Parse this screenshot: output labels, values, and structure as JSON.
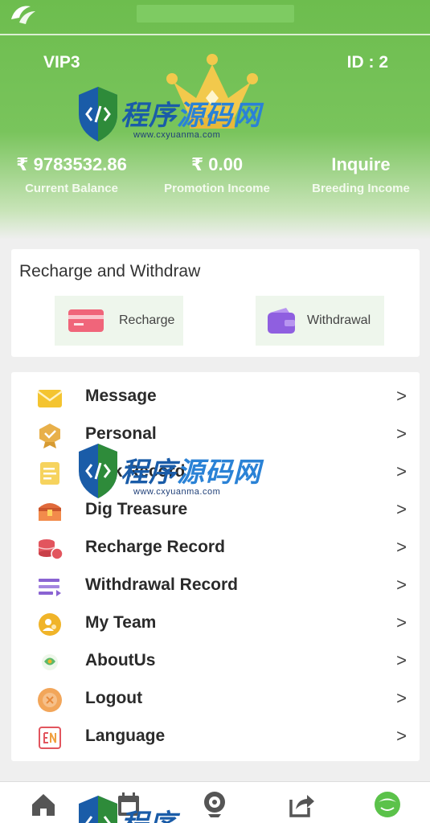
{
  "header": {
    "vip_level": "VIP3",
    "user_id": "ID : 2",
    "stats": [
      {
        "value": "₹ 9783532.86",
        "label": "Current Balance"
      },
      {
        "value": "₹ 0.00",
        "label": "Promotion Income"
      },
      {
        "value": "Inquire",
        "label": "Breeding Income"
      }
    ]
  },
  "recharge_withdraw": {
    "title": "Recharge and Withdraw",
    "recharge_label": "Recharge",
    "withdrawal_label": "Withdrawal"
  },
  "menu": {
    "items": [
      {
        "label": "Message",
        "icon": "envelope-icon",
        "color": "#f4c430"
      },
      {
        "label": "Personal",
        "icon": "badge-icon",
        "color": "#e8b04a"
      },
      {
        "label": "Task Record",
        "icon": "document-icon",
        "color": "#f6d35e"
      },
      {
        "label": "Dig Treasure",
        "icon": "treasure-chest-icon",
        "color": "#e06a3b"
      },
      {
        "label": "Recharge Record",
        "icon": "coins-icon",
        "color": "#e2555e"
      },
      {
        "label": "Withdrawal Record",
        "icon": "list-icon",
        "color": "#8a63d2"
      },
      {
        "label": "My Team",
        "icon": "team-icon",
        "color": "#f0b429"
      },
      {
        "label": "AboutUs",
        "icon": "info-icon",
        "color": "#5bb96a"
      },
      {
        "label": "Logout",
        "icon": "logout-icon",
        "color": "#f2a65a"
      },
      {
        "label": "Language",
        "icon": "language-icon",
        "color": "#e2555e"
      }
    ],
    "arrow": ">"
  },
  "watermark": {
    "text_a": "程序",
    "text_b": "源码网",
    "url": "www.cxyuanma.com"
  },
  "colors": {
    "header_green": "#6dbd4e",
    "crown_gold": "#f2c94c",
    "recharge_red": "#f0657a",
    "withdraw_purple": "#8f5fe0"
  }
}
